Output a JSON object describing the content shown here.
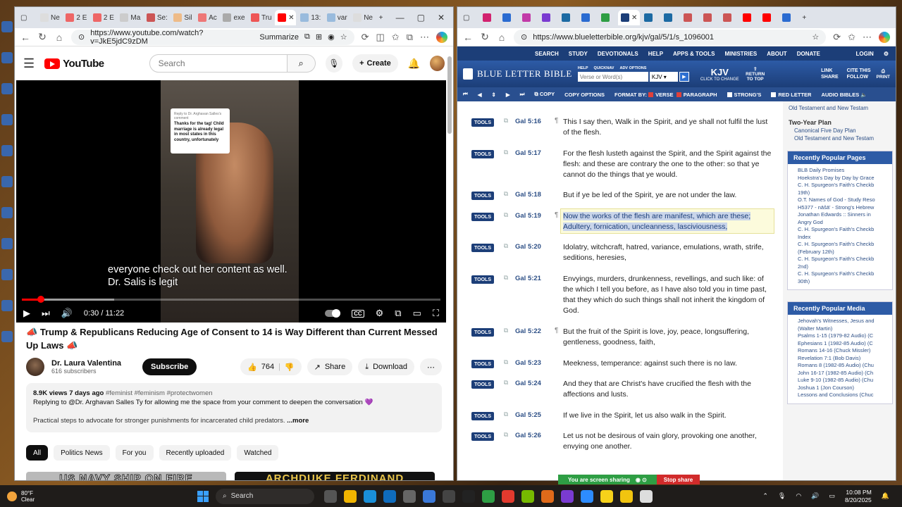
{
  "colors": {
    "yt_red": "#ff0000",
    "blb_blue": "#1c3e78",
    "blb_link": "#2d4f86",
    "highlight": "#fcfbdc"
  },
  "left_browser": {
    "tabs": [
      "Ne",
      "2 E",
      "2 E",
      "Ma",
      "Se:",
      "Sil",
      "Ac",
      "exe",
      "Tru",
      "",
      "13:",
      "var",
      "Ne"
    ],
    "url": "https://www.youtube.com/watch?v=JkE5jdC9zDM",
    "summarize": "Summarize"
  },
  "youtube": {
    "logo": "YouTube",
    "search_placeholder": "Search",
    "create": "Create",
    "video_card": {
      "reply_to": "Reply to Dr. Arghavan Salles's comment",
      "text": "Thanks for the tag! Child marriage is already legal in most states in this country, unfortunately"
    },
    "caption_line1": "everyone check out her content as well.",
    "caption_line2": "Dr. Salis is legit",
    "time": "0:30 / 11:22",
    "progress_fraction": 0.045,
    "title": "Trump & Republicans Reducing Age of Consent to 14 is Way Different than Current Messed Up Laws",
    "channel_name": "Dr. Laura Valentina",
    "subscribers": "616 subscribers",
    "subscribe": "Subscribe",
    "likes": "764",
    "share": "Share",
    "download": "Download",
    "views_date": "8.9K views  7 days ago",
    "hashtags": "#feminist #feminism #protectwomen",
    "desc_line1": "Replying to @Dr. Arghavan Salles Ty for allowing me the space from your comment to deepen the conversation",
    "desc_line2": "Practical steps to advocate for stronger punishments for incarcerated child predators.",
    "more": "...more",
    "chips": [
      "All",
      "Politics News",
      "For you",
      "Recently uploaded",
      "Watched"
    ],
    "thumb1": "US NAVY SHIP ON FIRE",
    "thumb2": "ARCHDUKE FERDINAND"
  },
  "right_browser": {
    "url": "https://www.blueletterbible.org/kjv/gal/5/1/s_1096001"
  },
  "blb": {
    "nav": [
      "SEARCH",
      "STUDY",
      "DEVOTIONALS",
      "HELP",
      "APPS & TOOLS",
      "MINISTRIES",
      "ABOUT",
      "DONATE"
    ],
    "login": "LOGIN",
    "logo": "BLUE LETTER BIBLE",
    "search_mini": [
      "HELP",
      "QUICKNAV",
      "ADV OPTIONS"
    ],
    "search_placeholder": "Verse or Word(s)",
    "version": "KJV",
    "version_label": "KJV",
    "click_to_change": "CLICK TO CHANGE",
    "return_top": "RETURN TO TOP",
    "link": "LINK",
    "cite": "CITE THIS",
    "share": "SHARE",
    "follow": "FOLLOW",
    "print": "PRINT",
    "toolbar": {
      "copy": "COPY",
      "copy_options": "COPY OPTIONS",
      "format_by": "FORMAT BY:",
      "verse": "VERSE",
      "paragraph": "PARAGRAPH",
      "strongs": "STRONG'S",
      "red_letter": "RED LETTER",
      "audio": "AUDIO BIBLES"
    },
    "tools_label": "TOOLS",
    "verses": [
      {
        "ref": "Gal 5:16",
        "text": "This I say then, Walk in the Spirit, and ye shall not fulfil the lust of the flesh."
      },
      {
        "ref": "Gal 5:17",
        "text": "For the flesh lusteth against the Spirit, and the Spirit against the flesh: and these are contrary the one to the other: so that ye cannot do the things that ye would."
      },
      {
        "ref": "Gal 5:18",
        "text": "But if ye be led of the Spirit, ye are not under the law."
      },
      {
        "ref": "Gal 5:19",
        "text": "Now the works of the flesh are manifest, which are these; Adultery, fornication, uncleanness, lasciviousness,"
      },
      {
        "ref": "Gal 5:20",
        "text": "Idolatry, witchcraft, hatred, variance, emulations, wrath, strife, seditions, heresies,"
      },
      {
        "ref": "Gal 5:21",
        "text": "Envyings, murders, drunkenness, revellings, and such like: of the which I tell you before, as I have also told you in time past, that they which do such things shall not inherit the kingdom of God."
      },
      {
        "ref": "Gal 5:22",
        "text": "But the fruit of the Spirit is love, joy, peace, longsuffering, gentleness, goodness, faith,"
      },
      {
        "ref": "Gal 5:23",
        "text": "Meekness, temperance: against such there is no law."
      },
      {
        "ref": "Gal 5:24",
        "text": "And they that are Christ's have crucified the flesh with the affections and lusts."
      },
      {
        "ref": "Gal 5:25",
        "text": "If we live in the Spirit, let us also walk in the Spirit."
      },
      {
        "ref": "Gal 5:26",
        "text": "Let us not be desirous of vain glory, provoking one another, envying one another."
      }
    ],
    "side_top": {
      "ot_nt_1": "Old Testament and New Testam",
      "two_year": "Two-Year Plan",
      "canonical": "Canonical Five Day Plan",
      "ot_nt_2": "Old Testament and New Testam"
    },
    "recent_pages_title": "Recently Popular Pages",
    "recent_pages": [
      "BLB Daily Promises",
      "Hoekstra's Day by Day by Grace",
      "C. H. Spurgeon's Faith's Checkb",
      "19th)",
      "O.T. Names of God - Study Reso",
      "H5377 - nāšā' - Strong's Hebrew",
      "Jonathan Edwards :: Sinners in",
      "Angry God",
      "C. H. Spurgeon's Faith's Checkb",
      "Index",
      "C. H. Spurgeon's Faith's Checkb",
      "(February 12th)",
      "C. H. Spurgeon's Faith's Checkb",
      "2nd)",
      "C. H. Spurgeon's Faith's Checkb",
      "30th)"
    ],
    "recent_media_title": "Recently Popular Media",
    "recent_media": [
      "Jehovah's Witnesses, Jesus and",
      "(Walter Martin)",
      "Psalms 1-15 (1979-82 Audio) (C",
      "Ephesians 1 (1982-85 Audio) (C",
      "Romans 14-16 (Chuck Missler)",
      "Revelation 7:1 (Bob Davis)",
      "Romans 8 (1982-85 Audio) (Chu",
      "John 16-17 (1982-85 Audio) (Ch",
      "Luke 9-10 (1982-85 Audio) (Chu",
      "Joshua 1 (Jon Courson)",
      "Lessons and Conclusions (Chuc"
    ]
  },
  "screenshare": {
    "text": "You are screen sharing",
    "stop": "Stop share"
  },
  "taskbar": {
    "temp": "80°F",
    "weather": "Clear",
    "search": "Search",
    "time": "10:08 PM",
    "date": "8/20/2025"
  }
}
